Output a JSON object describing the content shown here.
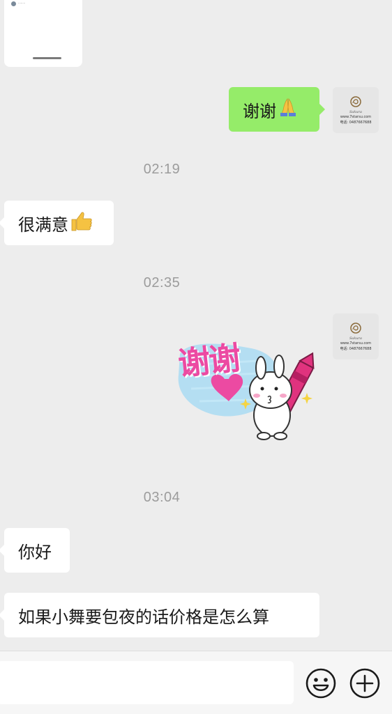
{
  "top_card": {
    "tiny_text": "········"
  },
  "avatar": {
    "brand": "Sakura",
    "site": "www.7starsu.com",
    "phone": "电话: 0487667688"
  },
  "messages": {
    "thanks_text": "谢谢",
    "thanks_emoji": "pray",
    "time_1": "02:19",
    "satisfied_text": "很满意",
    "satisfied_emoji": "thumbs-up",
    "time_2": "02:35",
    "sticker_text": "谢谢",
    "time_3": "03:04",
    "hello_text": "你好",
    "price_question": "如果小舞要包夜的话价格是怎么算"
  },
  "input": {
    "value": "",
    "placeholder": ""
  },
  "icons": {
    "emoji_button": "smiley-face-icon",
    "plus_button": "plus-circle-icon"
  },
  "colors": {
    "background": "#ededed",
    "incoming_bubble": "#ffffff",
    "outgoing_bubble": "#95ec69",
    "timestamp": "#9c9c9c",
    "sticker_pink": "#ec4aa2"
  }
}
